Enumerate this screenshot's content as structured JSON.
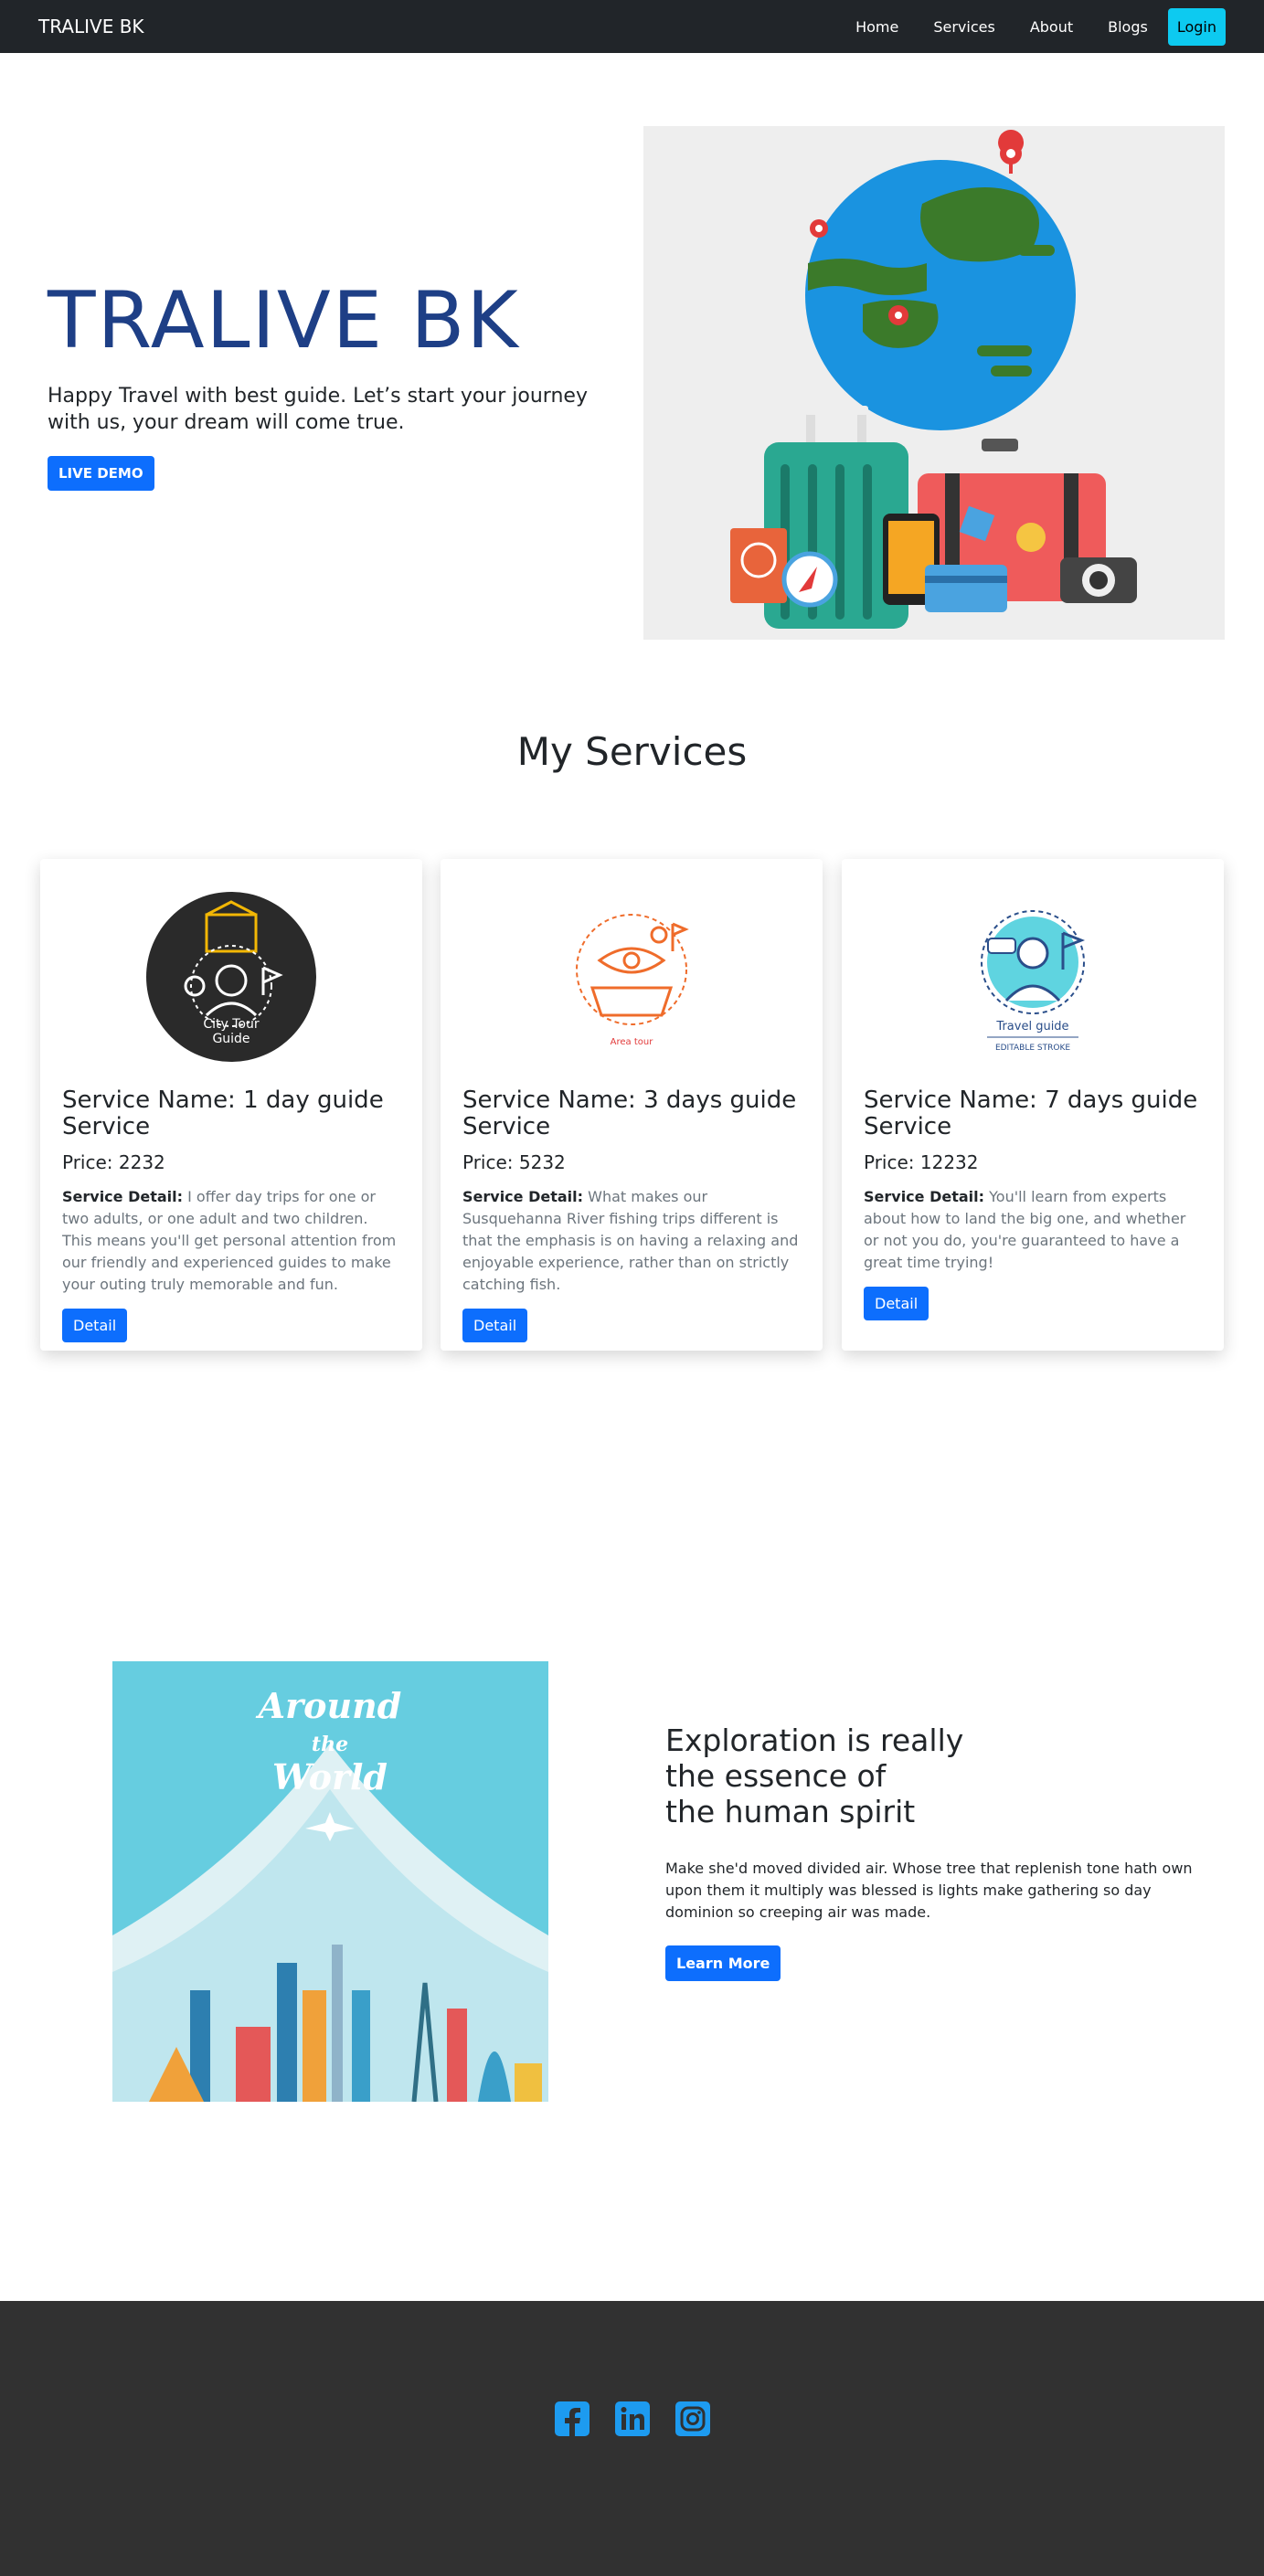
{
  "navbar": {
    "brand": "TRALIVE BK",
    "links": [
      "Home",
      "Services",
      "About",
      "Blogs"
    ],
    "login": "Login"
  },
  "hero": {
    "title": "TRALIVE BK",
    "subtitle": "Happy Travel with best guide. Let’s start your journey with us, your dream will come true.",
    "button": "LIVE DEMO"
  },
  "services": {
    "heading": "My Services",
    "detail_prefix": "Service Detail:",
    "cards": [
      {
        "name": "Service Name: 1 day guide Service",
        "price": "Price: 2232",
        "detail": "I offer day trips for one or two adults, or one adult and two children. This means you'll get personal attention from our friendly and experienced guides to make your outing truly memorable and fun.",
        "button": "Detail",
        "image_text": [
          "City Tour",
          "Guide"
        ]
      },
      {
        "name": "Service Name: 3 days guide Service",
        "price": "Price: 5232",
        "detail": "What makes our Susquehanna River fishing trips different is that the emphasis is on having a relaxing and enjoyable experience, rather than on strictly catching fish.",
        "button": "Detail",
        "image_text": [
          "Area tour"
        ]
      },
      {
        "name": "Service Name: 7 days guide Service",
        "price": "Price: 12232",
        "detail": "You'll learn from experts about how to land the big one, and whether or not you do, you're guaranteed to have a great time trying!",
        "button": "Detail",
        "image_text": [
          "Travel guide",
          "EDITABLE STROKE"
        ]
      }
    ]
  },
  "explore": {
    "image_text": [
      "Around",
      "the",
      "World"
    ],
    "title_lines": [
      "Exploration is really",
      "the essence of",
      "the human spirit"
    ],
    "body": "Make she'd moved divided air. Whose tree that replenish tone hath own upon them it multiply was blessed is lights make gathering so day dominion so creeping air was made.",
    "button": "Learn More"
  },
  "footer": {
    "icons": [
      "facebook-icon",
      "linkedin-icon",
      "instagram-icon"
    ],
    "icon_color": "#1d9bf0"
  }
}
